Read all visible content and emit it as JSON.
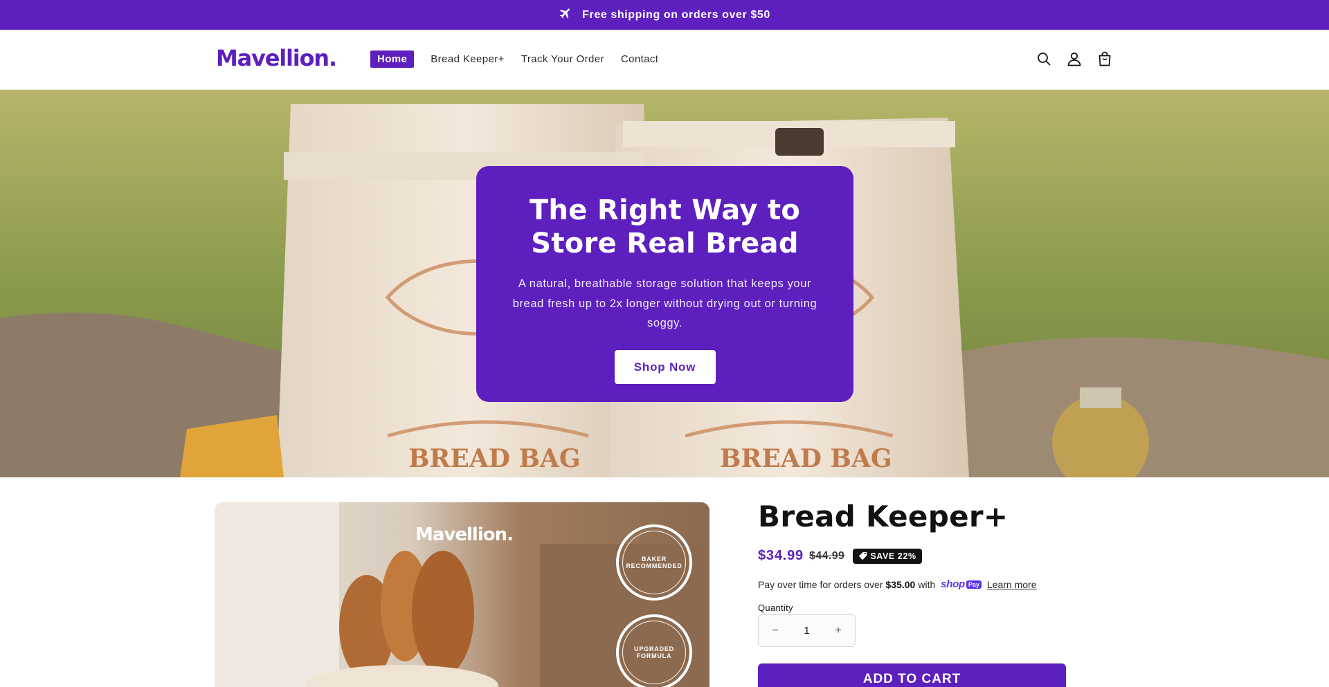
{
  "announcement": {
    "text": "Free shipping on orders over $50",
    "icon": "airplane-icon"
  },
  "header": {
    "logo": "Mavellion.",
    "nav": [
      {
        "label": "Home",
        "active": true
      },
      {
        "label": "Bread Keeper+"
      },
      {
        "label": "Track Your Order"
      },
      {
        "label": "Contact"
      }
    ],
    "icons": [
      "search-icon",
      "account-icon",
      "cart-icon"
    ]
  },
  "hero": {
    "title": "The Right Way to Store Real Bread",
    "subtitle": "A natural, breathable storage solution that keeps your bread fresh up to 2x longer without drying out or turning soggy.",
    "button": "Shop Now",
    "image_text": "BREAD BAG"
  },
  "product": {
    "image": {
      "logo": "Mavellion.",
      "badge_1": "BAKER RECOMMENDED",
      "badge_2": "UPGRADED FORMULA"
    },
    "title": "Bread Keeper+",
    "price_sale": "$34.99",
    "price_regular": "$44.99",
    "save_badge": "SAVE 22%",
    "installments": {
      "prefix": "Pay over time for orders over",
      "amount": "$35.00",
      "with": "with",
      "shoppay_word": "shop",
      "shoppay_pill": "Pay",
      "learn_more": "Learn more"
    },
    "quantity_label": "Quantity",
    "quantity_value": "1",
    "qty_minus": "−",
    "qty_plus": "+",
    "add_to_cart": "ADD TO CART"
  },
  "colors": {
    "brand": "#5d1fbd",
    "shoppay": "#5a31f4"
  }
}
